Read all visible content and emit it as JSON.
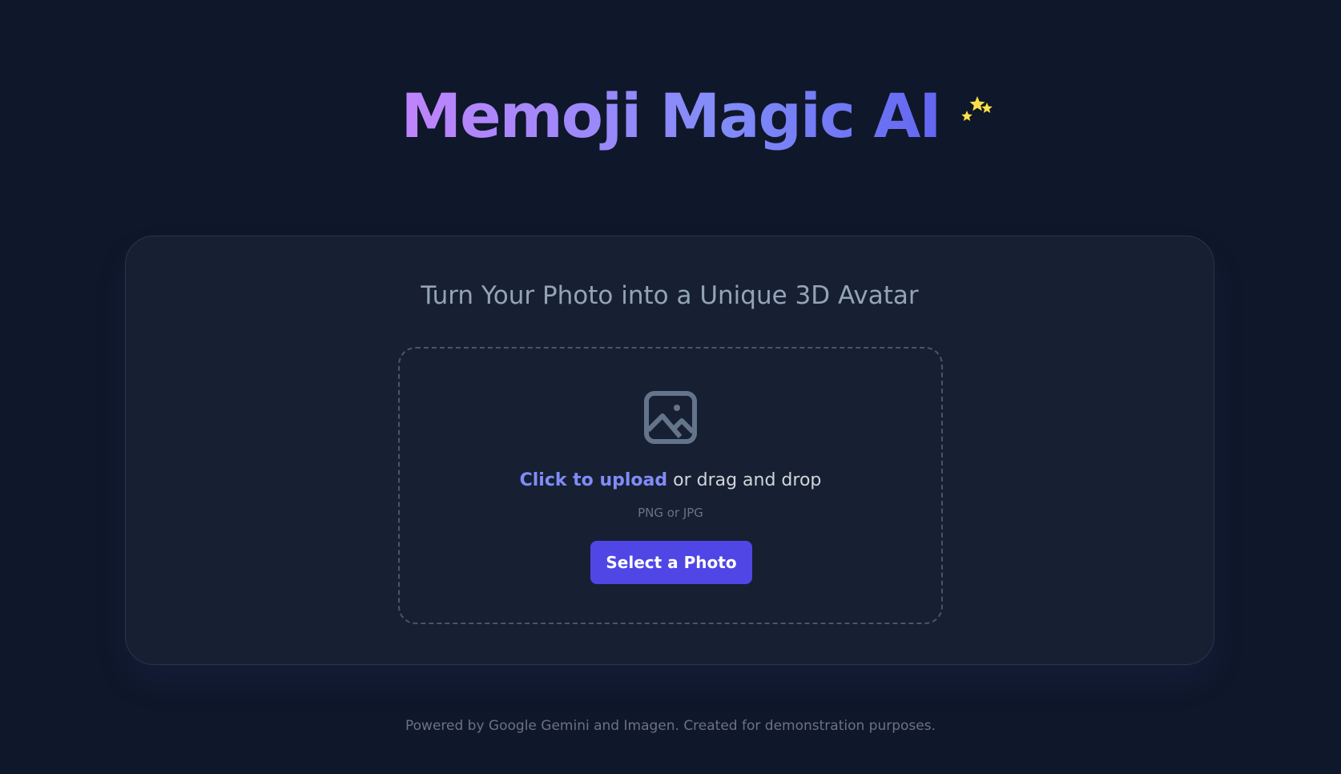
{
  "header": {
    "title": "Memoji Magic AI",
    "sparkle_icon": "sparkles-icon"
  },
  "card": {
    "subtitle": "Turn Your Photo into a Unique 3D Avatar",
    "dropzone": {
      "icon": "image-icon",
      "link_text": "Click to upload",
      "rest_text": " or drag and drop",
      "formats": "PNG or JPG",
      "button_label": "Select a Photo"
    }
  },
  "footer": {
    "text": "Powered by Google Gemini and Imagen. Created for demonstration purposes."
  },
  "colors": {
    "background": "#0f172a",
    "card": "#162032",
    "accent": "#4f46e5",
    "link": "#818cf8",
    "title_gradient_start": "#c084fc",
    "title_gradient_end": "#6366f1",
    "sparkle": "#fde047"
  }
}
